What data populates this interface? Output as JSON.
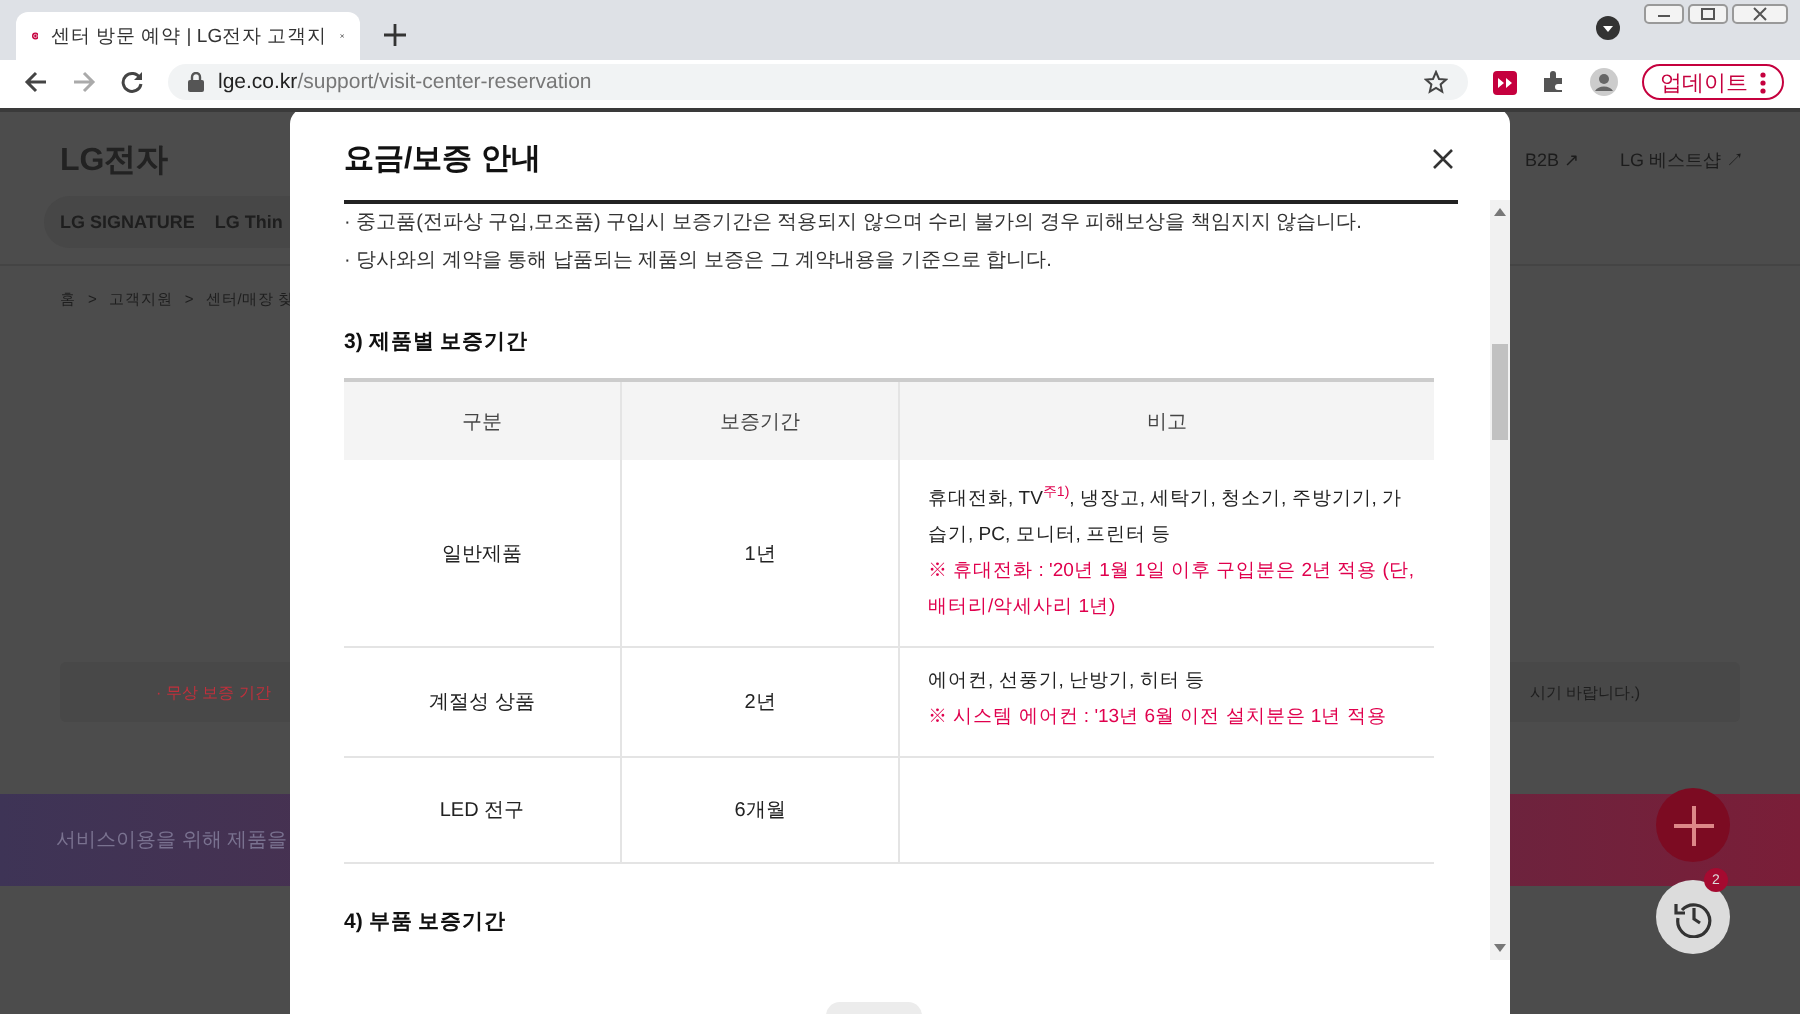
{
  "browser": {
    "tab_title": "센터 방문 예약 | LG전자 고객지",
    "url_host": "lge.co.kr",
    "url_path": "/support/visit-center-reservation",
    "update_label": "업데이트"
  },
  "background_page": {
    "logo": "LG전자",
    "nav": [
      "LG SIGNATURE",
      "LG Thin"
    ],
    "links": [
      "B2B ↗",
      "LG 베스트샵 ↗"
    ],
    "breadcrumb": [
      "홈",
      "고객지원",
      "센터/매장 찾"
    ],
    "breadcrumb_separator": ">",
    "notice_left": "· 무상 보증 기간",
    "notice_right": "시기 바랍니다.)",
    "banner_text": "서비스이용을 위해 제품을",
    "history_badge": "2"
  },
  "modal": {
    "title": "요금/보증 안내",
    "notes": [
      "· 중고품(전파상 구입,모조품) 구입시 보증기간은 적용되지 않으며 수리 불가의 경우 피해보상을 책임지지 않습니다.",
      "· 당사와의 계약을 통해 납품되는 제품의 보증은 그 계약내용을 기준으로 합니다."
    ],
    "section_heading": "3) 제품별 보증기간",
    "table": {
      "columns": [
        "구분",
        "보증기간",
        "비고"
      ],
      "rows": [
        {
          "category": "일반제품",
          "period": "1년",
          "remarks": [
            {
              "kind": "normal",
              "text": "휴대전화, TV$^{주1)}$, 냉장고, 세탁기, 청소기, 주방기기, 가습기, PC, 모니터, 프린터 등"
            },
            {
              "kind": "note",
              "text": "※ 휴대전화 : '20년 1월 1일 이후 구입분은 2년 적용 (단, 배터리/악세사리 1년)"
            }
          ]
        },
        {
          "category": "계절성 상품",
          "period": "2년",
          "remarks": [
            {
              "kind": "normal",
              "text": "에어컨, 선풍기, 난방기, 히터 등"
            },
            {
              "kind": "note",
              "text": "※ 시스템 에어컨 : '13년 6월 이전 설치분은 1년 적용"
            }
          ]
        },
        {
          "category": "LED 전구",
          "period": "6개월",
          "remarks": []
        }
      ]
    },
    "next_heading": "4) 부품 보증기간"
  }
}
